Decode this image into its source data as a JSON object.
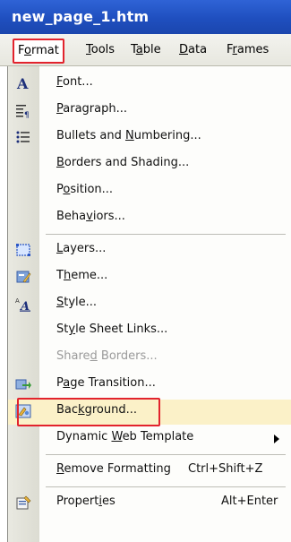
{
  "window": {
    "title": "new_page_1.htm"
  },
  "menubar": {
    "items": [
      {
        "label_pre": "F",
        "label_u": "o",
        "label_post": "rmat"
      },
      {
        "label_pre": "",
        "label_u": "T",
        "label_post": "ools"
      },
      {
        "label_pre": "T",
        "label_u": "a",
        "label_post": "ble"
      },
      {
        "label_pre": "",
        "label_u": "D",
        "label_post": "ata"
      },
      {
        "label_pre": "F",
        "label_u": "r",
        "label_post": "ames"
      }
    ]
  },
  "format_menu": {
    "items": [
      {
        "pre": "",
        "u": "F",
        "post": "ont...",
        "shortcut": ""
      },
      {
        "pre": "",
        "u": "P",
        "post": "aragraph...",
        "shortcut": ""
      },
      {
        "pre": "Bullets and ",
        "u": "N",
        "post": "umbering...",
        "shortcut": ""
      },
      {
        "pre": "",
        "u": "B",
        "post": "orders and Shading...",
        "shortcut": ""
      },
      {
        "pre": "P",
        "u": "o",
        "post": "sition...",
        "shortcut": ""
      },
      {
        "pre": "Beha",
        "u": "v",
        "post": "iors...",
        "shortcut": ""
      },
      {
        "pre": "",
        "u": "L",
        "post": "ayers...",
        "shortcut": ""
      },
      {
        "pre": "T",
        "u": "h",
        "post": "eme...",
        "shortcut": ""
      },
      {
        "pre": "",
        "u": "S",
        "post": "tyle...",
        "shortcut": ""
      },
      {
        "pre": "St",
        "u": "y",
        "post": "le Sheet Links...",
        "shortcut": ""
      },
      {
        "pre": "Share",
        "u": "d",
        "post": " Borders...",
        "shortcut": ""
      },
      {
        "pre": "P",
        "u": "a",
        "post": "ge Transition...",
        "shortcut": ""
      },
      {
        "pre": "Bac",
        "u": "k",
        "post": "ground...",
        "shortcut": ""
      },
      {
        "pre": "Dynamic ",
        "u": "W",
        "post": "eb Template",
        "shortcut": ""
      },
      {
        "pre": "",
        "u": "R",
        "post": "emove Formatting",
        "shortcut": "Ctrl+Shift+Z"
      },
      {
        "pre": "Propert",
        "u": "i",
        "post": "es",
        "shortcut": "Alt+Enter"
      }
    ]
  },
  "colors": {
    "title_bar": "#1f4fbf",
    "highlight": "#fbf1c8",
    "callout_red": "#e2232d"
  },
  "icons": [
    "font-icon",
    "paragraph-icon",
    "bullets-icon",
    "layers-icon",
    "theme-icon",
    "style-icon",
    "page-transition-icon",
    "background-icon",
    "properties-icon"
  ]
}
